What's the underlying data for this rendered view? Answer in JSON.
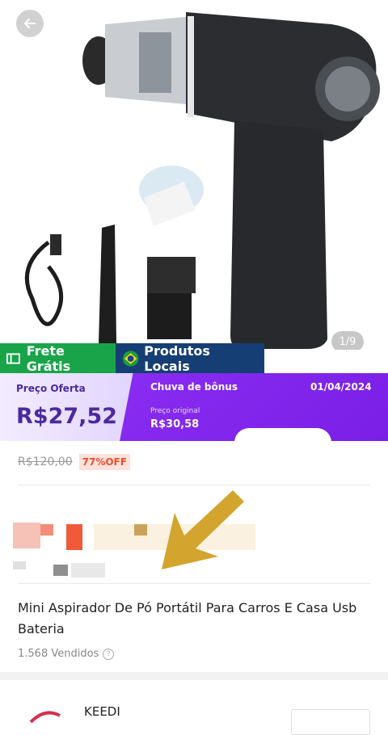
{
  "gallery": {
    "counter": "1/9",
    "back_icon": "arrow-left-icon"
  },
  "badges": {
    "free_shipping": "Frete Grátis",
    "local_products": "Produtos Locais",
    "free_color": "#19a44a",
    "local_color": "#153f74"
  },
  "price": {
    "offer_label": "Preço Oferta",
    "offer_value": "R$27,52",
    "bonus_label": "Chuva de bônus",
    "bonus_date": "01/04/2024",
    "original_label": "Preço original",
    "original_value": "R$30,58",
    "accent": "#7a1fe6"
  },
  "discount": {
    "old_price": "R$120,00",
    "percent_off": "77%OFF"
  },
  "product": {
    "title": "Mini Aspirador De Pó Portátil Para Carros E Casa Usb Bateria",
    "sold": "1.568 Vendidos"
  },
  "shop": {
    "name": "KEEDI"
  }
}
